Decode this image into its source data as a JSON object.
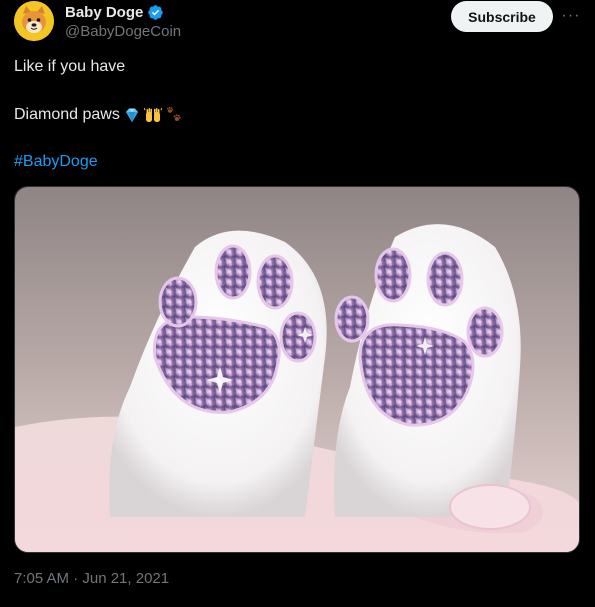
{
  "author": {
    "display_name": "Baby Doge",
    "handle": "@BabyDogeCoin",
    "verified": true,
    "avatar_icon": "shiba-inu-avatar-icon"
  },
  "actions": {
    "subscribe_label": "Subscribe",
    "more_label": "···"
  },
  "tweet": {
    "line1": "Like if you have",
    "line2": "Diamond paws",
    "emojis": [
      "gem-stone-icon",
      "raising-hands-icon",
      "paw-prints-icon"
    ],
    "hashtag": "#BabyDoge",
    "media_icon": "diamond-cat-paws-image",
    "timestamp": "7:05 AM · Jun 21, 2021"
  },
  "colors": {
    "background": "#000000",
    "text": "#e7e9ea",
    "secondary_text": "#71767b",
    "link": "#1d9bf0",
    "verified_badge": "#1d9bf0",
    "button_bg": "#eff3f4"
  }
}
